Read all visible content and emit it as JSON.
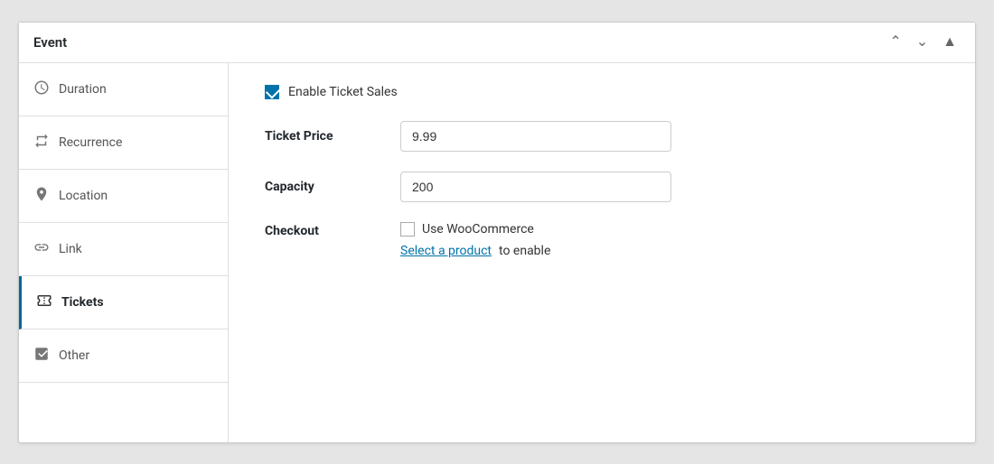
{
  "widget": {
    "title": "Event",
    "controls": {
      "up": "▲",
      "down": "▼",
      "expand": "▲"
    }
  },
  "sidebar": {
    "items": [
      {
        "id": "duration",
        "label": "Duration",
        "icon": "clock"
      },
      {
        "id": "recurrence",
        "label": "Recurrence",
        "icon": "recurrence"
      },
      {
        "id": "location",
        "label": "Location",
        "icon": "location"
      },
      {
        "id": "link",
        "label": "Link",
        "icon": "link"
      },
      {
        "id": "tickets",
        "label": "Tickets",
        "icon": "tickets",
        "active": true
      },
      {
        "id": "other",
        "label": "Other",
        "icon": "other"
      }
    ]
  },
  "main": {
    "enable_ticket_sales_label": "Enable Ticket Sales",
    "ticket_price_label": "Ticket Price",
    "ticket_price_value": "9.99",
    "capacity_label": "Capacity",
    "capacity_value": "200",
    "checkout_label": "Checkout",
    "woocommerce_label": "Use WooCommerce",
    "select_product_label": "Select a product",
    "to_enable_label": " to enable"
  }
}
